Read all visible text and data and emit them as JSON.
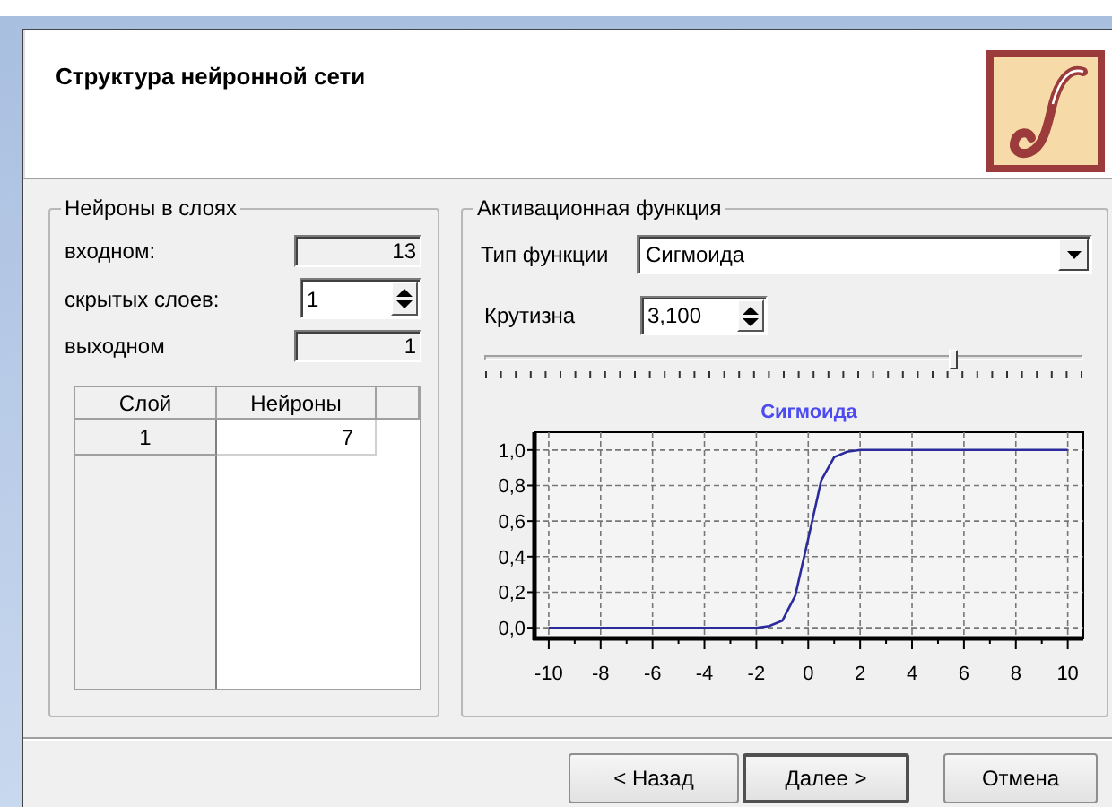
{
  "dialog": {
    "title": "Структура нейронной сети"
  },
  "neurons_group": {
    "title": "Нейроны в слоях",
    "fields": [
      {
        "kind": "readonly",
        "label": "входном:",
        "value": "13"
      },
      {
        "kind": "spin",
        "label": "скрытых слоев:",
        "value": "1"
      },
      {
        "kind": "readonly",
        "label": "выходном",
        "value": "1"
      }
    ],
    "table": {
      "columns": [
        "Слой",
        "Нейроны"
      ],
      "rows": [
        [
          "1",
          "7"
        ]
      ]
    }
  },
  "activation_group": {
    "title": "Активационная функция",
    "type": {
      "label": "Тип функции",
      "value": "Сигмоида"
    },
    "steepness": {
      "label": "Крутизна",
      "value": "3,100"
    },
    "slider": {
      "level": 0.78
    },
    "chart_data": {
      "type": "line",
      "title": "Сигмоида",
      "x": [
        -10,
        -2,
        -1.5,
        -1,
        -0.5,
        0,
        0.5,
        1,
        1.5,
        2,
        10
      ],
      "series": [
        {
          "color": "#2b2b9c",
          "values": [
            0,
            0,
            0.01,
            0.04,
            0.18,
            0.5,
            0.83,
            0.96,
            0.99,
            1,
            1
          ]
        }
      ],
      "grid": true,
      "xlim": [
        -10.55,
        10.6
      ],
      "ylim": [
        -0.06,
        1.1
      ],
      "xticks": [
        -10,
        -8,
        -6,
        -4,
        -2,
        0,
        2,
        4,
        6,
        8,
        10
      ],
      "yticks": [
        {
          "value": 0,
          "label": "0,0"
        },
        {
          "value": 0.2,
          "label": "0,2"
        },
        {
          "value": 0.4,
          "label": "0,4"
        },
        {
          "value": 0.6,
          "label": "0,6"
        },
        {
          "value": 0.8,
          "label": "0,8"
        },
        {
          "value": 1,
          "label": "1,0"
        }
      ]
    }
  },
  "buttons": [
    {
      "label": "< Назад",
      "default": false
    },
    {
      "label": "Далее >",
      "default": true
    },
    {
      "label": "Отмена",
      "default": false
    }
  ]
}
